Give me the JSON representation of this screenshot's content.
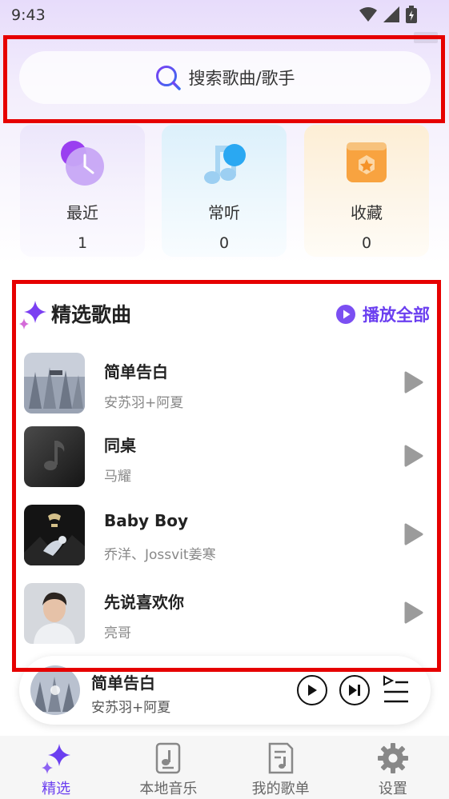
{
  "status_bar": {
    "time": "9:43"
  },
  "search": {
    "placeholder": "搜索歌曲/歌手"
  },
  "quick_cards": [
    {
      "label": "最近",
      "count": "1",
      "icon": "clock-icon"
    },
    {
      "label": "常听",
      "count": "0",
      "icon": "music-note-icon"
    },
    {
      "label": "收藏",
      "count": "0",
      "icon": "star-box-icon"
    }
  ],
  "featured": {
    "title": "精选歌曲",
    "play_all_label": "播放全部",
    "songs": [
      {
        "title": "简单告白",
        "artist": "安苏羽+阿夏"
      },
      {
        "title": "同桌",
        "artist": "马耀"
      },
      {
        "title": "Baby Boy",
        "artist": "乔洋、Jossvit姜寒"
      },
      {
        "title": "先说喜欢你",
        "artist": "亮哥"
      }
    ]
  },
  "mini_player": {
    "title": "简单告白",
    "artist": "安苏羽+阿夏"
  },
  "bottom_nav": [
    {
      "label": "精选",
      "active": true
    },
    {
      "label": "本地音乐",
      "active": false
    },
    {
      "label": "我的歌单",
      "active": false
    },
    {
      "label": "设置",
      "active": false
    }
  ],
  "colors": {
    "accent": "#6b3ff0",
    "highlight_box": "#e60000"
  }
}
